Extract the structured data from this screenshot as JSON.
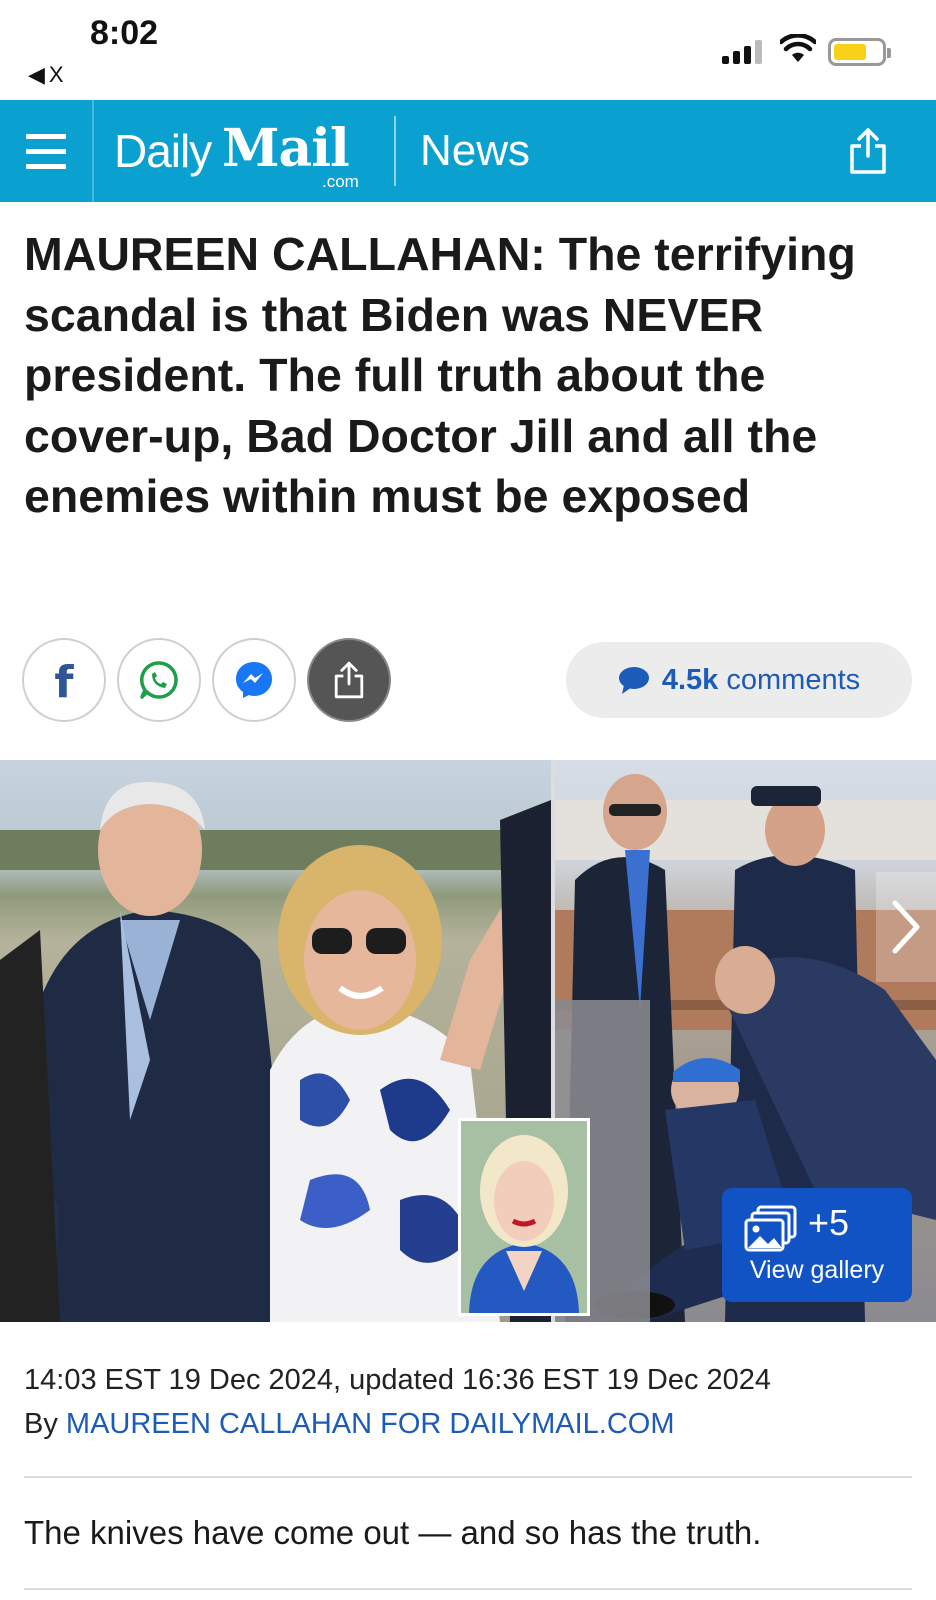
{
  "status_bar": {
    "time": "8:02",
    "back_label": "X",
    "battery_color": "#f7d219"
  },
  "header": {
    "logo_daily": "Daily",
    "logo_mail": "Mail",
    "logo_com": ".com",
    "section": "News",
    "background_color": "#0aa0d0",
    "menu_icon": "hamburger-menu-icon",
    "share_icon": "share-icon"
  },
  "article": {
    "headline": "MAUREEN CALLAHAN: The terrifying scandal is that Biden was NEVER president. The full truth about the cover-up, Bad Doctor Jill and all the enemies within must be exposed",
    "timestamp": "14:03 EST 19 Dec 2024, updated 16:36 EST 19 Dec 2024",
    "byline_prefix": "By",
    "byline_author": "MAUREEN CALLAHAN FOR DAILYMAIL.COM",
    "lead": "The knives have come out — and so has the truth."
  },
  "social": {
    "buttons": [
      {
        "icon": "facebook-icon"
      },
      {
        "icon": "whatsapp-icon"
      },
      {
        "icon": "messenger-icon"
      },
      {
        "icon": "share-icon"
      }
    ],
    "comments_count": "4.5k",
    "comments_label": "comments",
    "comments_color": "#1d5bb8"
  },
  "gallery": {
    "extra_count": "+5",
    "view_label": "View gallery",
    "button_color": "#1153c4",
    "next_icon": "chevron-right-icon",
    "photos": [
      "biden-and-jill-photo",
      "biden-fall-photo",
      "author-portrait-photo"
    ]
  }
}
